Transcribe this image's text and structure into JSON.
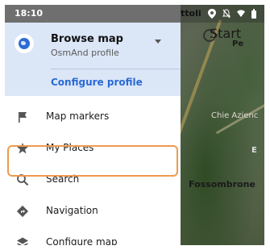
{
  "status_bar": {
    "time": "18:10",
    "map_crumb": "ttoli"
  },
  "drawer": {
    "header": {
      "title": "Browse map",
      "subtitle": "OsmAnd profile",
      "configure_profile": "Configure profile"
    },
    "menu": [
      {
        "label": "Map markers",
        "icon": "flag-icon"
      },
      {
        "label": "My Places",
        "icon": "star-icon"
      },
      {
        "label": "Search",
        "icon": "search-icon"
      },
      {
        "label": "Navigation",
        "icon": "navigation-icon"
      },
      {
        "label": "Configure map",
        "icon": "layers-icon"
      }
    ]
  },
  "map": {
    "labels": {
      "start": "Start",
      "pe": "Pe",
      "chie": "Chie Azienc",
      "fossombrone": "Fossombrone",
      "e": "E"
    }
  },
  "colors": {
    "header_bg": "#dbe6f7",
    "accent": "#2a6ad6",
    "highlight": "#ee9a4f"
  }
}
